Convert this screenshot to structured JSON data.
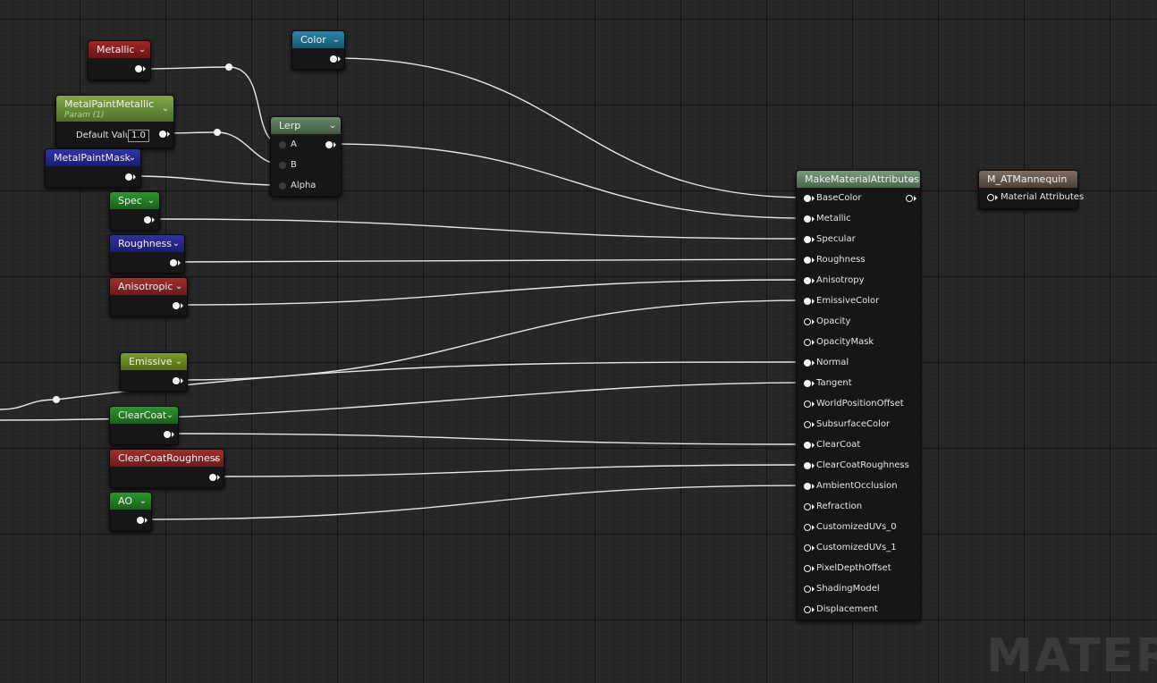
{
  "nodes": {
    "metallic": {
      "title": "Metallic"
    },
    "metal_paint_metallic": {
      "title": "MetalPaintMetallic",
      "subtitle": "Param (1)",
      "default_value_label": "Default Value",
      "default_value": "1.0"
    },
    "metal_paint_mask": {
      "title": "MetalPaintMask"
    },
    "color": {
      "title": "Color"
    },
    "lerp": {
      "title": "Lerp",
      "inputs": [
        "A",
        "B",
        "Alpha"
      ]
    },
    "spec": {
      "title": "Spec"
    },
    "roughness": {
      "title": "Roughness"
    },
    "anisotropic": {
      "title": "Anisotropic"
    },
    "emissive": {
      "title": "Emissive"
    },
    "clearcoat": {
      "title": "ClearCoat"
    },
    "clearcoat_roughness": {
      "title": "ClearCoatRoughness"
    },
    "ao": {
      "title": "AO"
    },
    "make_material_attributes": {
      "title": "MakeMaterialAttributes",
      "inputs": [
        "BaseColor",
        "Metallic",
        "Specular",
        "Roughness",
        "Anisotropy",
        "EmissiveColor",
        "Opacity",
        "OpacityMask",
        "Normal",
        "Tangent",
        "WorldPositionOffset",
        "SubsurfaceColor",
        "ClearCoat",
        "ClearCoatRoughness",
        "AmbientOcclusion",
        "Refraction",
        "CustomizedUVs_0",
        "CustomizedUVs_1",
        "PixelDepthOffset",
        "ShadingModel",
        "Displacement"
      ]
    },
    "m_at_mannequin": {
      "title": "M_ATMannequin",
      "input": "Material Attributes"
    }
  },
  "colors": {
    "scalar_red": "#8a1c1c",
    "param_green": "#6a8c3a",
    "vector_blue": "#1f6f8c",
    "mask_blue": "#2a2a8a",
    "spec_green": "#2a7a2a",
    "lerp_green": "#4e6e4e",
    "make_green": "#5e7e5e",
    "result_brown": "#6e5e52",
    "anisotropic_red": "#8a2a2a",
    "emissive_olive": "#6a8a2a"
  },
  "watermark": "MATERI"
}
